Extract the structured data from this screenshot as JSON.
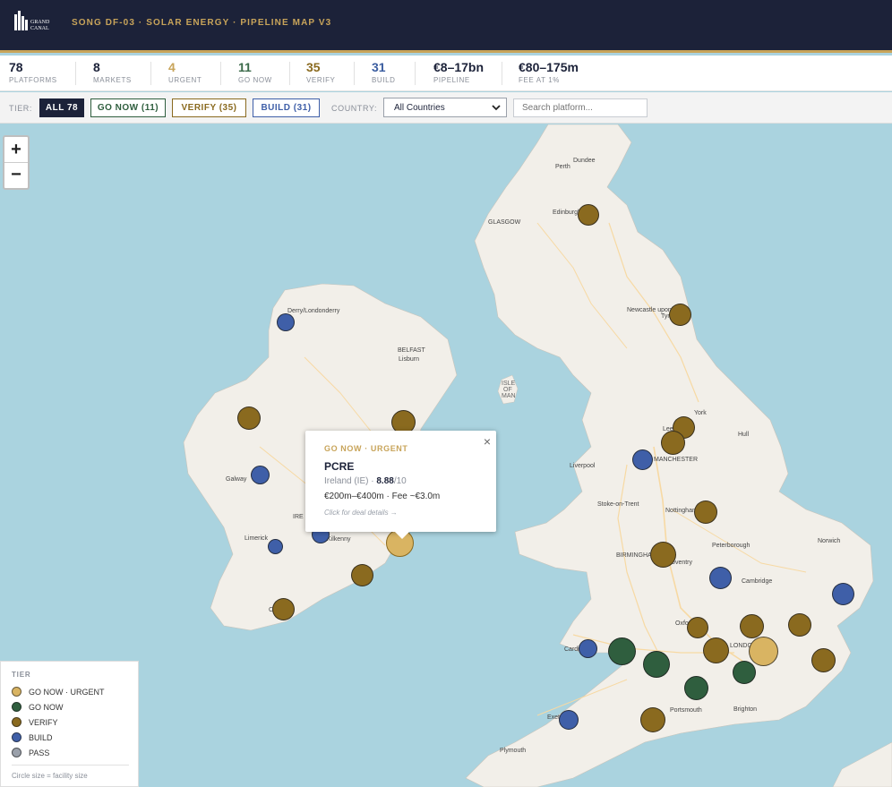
{
  "header": {
    "logo_text": [
      "GRAND",
      "CANAL"
    ],
    "title": "SONG DF-03 · SOLAR ENERGY · PIPELINE MAP V3"
  },
  "stats": [
    {
      "value": "78",
      "label": "PLATFORMS",
      "color": "#1c2239"
    },
    {
      "value": "8",
      "label": "MARKETS",
      "color": "#1c2239"
    },
    {
      "value": "4",
      "label": "URGENT",
      "color": "#c8a45a"
    },
    {
      "value": "11",
      "label": "GO NOW",
      "color": "#3b6a4a"
    },
    {
      "value": "35",
      "label": "VERIFY",
      "color": "#8a6a1f"
    },
    {
      "value": "31",
      "label": "BUILD",
      "color": "#3b5da0"
    },
    {
      "value": "€8–17bn",
      "label": "PIPELINE",
      "color": "#1c2239"
    },
    {
      "value": "€80–175m",
      "label": "FEE AT 1%",
      "color": "#1c2239"
    }
  ],
  "filters": {
    "tier_label": "TIER:",
    "buttons": [
      {
        "label": "ALL 78",
        "active": true
      },
      {
        "label": "GO NOW (11)",
        "active": false
      },
      {
        "label": "VERIFY (35)",
        "active": false
      },
      {
        "label": "BUILD (31)",
        "active": false
      }
    ],
    "country_label": "COUNTRY:",
    "country_selected": "All Countries",
    "search_placeholder": "Search platform..."
  },
  "zoom": {
    "plus": "+",
    "minus": "−"
  },
  "colors": {
    "go_now_urgent": "#d9b462",
    "go_now": "#2f5e3e",
    "verify": "#8a6a1f",
    "build": "#3f5fa8",
    "pass": "#9aa0aa",
    "land": "#f2efe9",
    "water": "#aad3df"
  },
  "cities": [
    "Dundee",
    "Perth",
    "Edinburgh",
    "GLASGOW",
    "Derry/Londonderry",
    "Newcastle upon",
    "Tyne",
    "BELFAST",
    "Lisburn",
    "ISLE",
    "OF",
    "MAN",
    "York",
    "Leeds",
    "Hull",
    "Liverpool",
    "MANCHESTER",
    "Galway",
    "IRE",
    "Limerick",
    "Kilkenny",
    "Cork",
    "Stoke-on-Trent",
    "Nottingham",
    "BIRMINGHAM",
    "Coventry",
    "Peterborough",
    "Norwich",
    "Cambridge",
    "Oxford",
    "Cardiff",
    "LONDON",
    "Portsmouth",
    "Brighton",
    "Exeter",
    "Plymouth"
  ],
  "popup": {
    "tier": "GO NOW · URGENT",
    "name": "PCRE",
    "location": "Ireland (IE) · ",
    "score": "8.88",
    "score_suffix": "/10",
    "value": "€200m–€400m · Fee ~€3.0m",
    "hint": "Click for deal details →",
    "close": "×"
  },
  "legend": {
    "title": "TIER",
    "items": [
      {
        "label": "GO NOW · URGENT",
        "color": "#d9b462"
      },
      {
        "label": "GO NOW",
        "color": "#2f5e3e"
      },
      {
        "label": "VERIFY",
        "color": "#8a6a1f"
      },
      {
        "label": "BUILD",
        "color": "#3f5fa8"
      },
      {
        "label": "PASS",
        "color": "#9aa0aa"
      }
    ],
    "note": "Circle size = facility size"
  }
}
